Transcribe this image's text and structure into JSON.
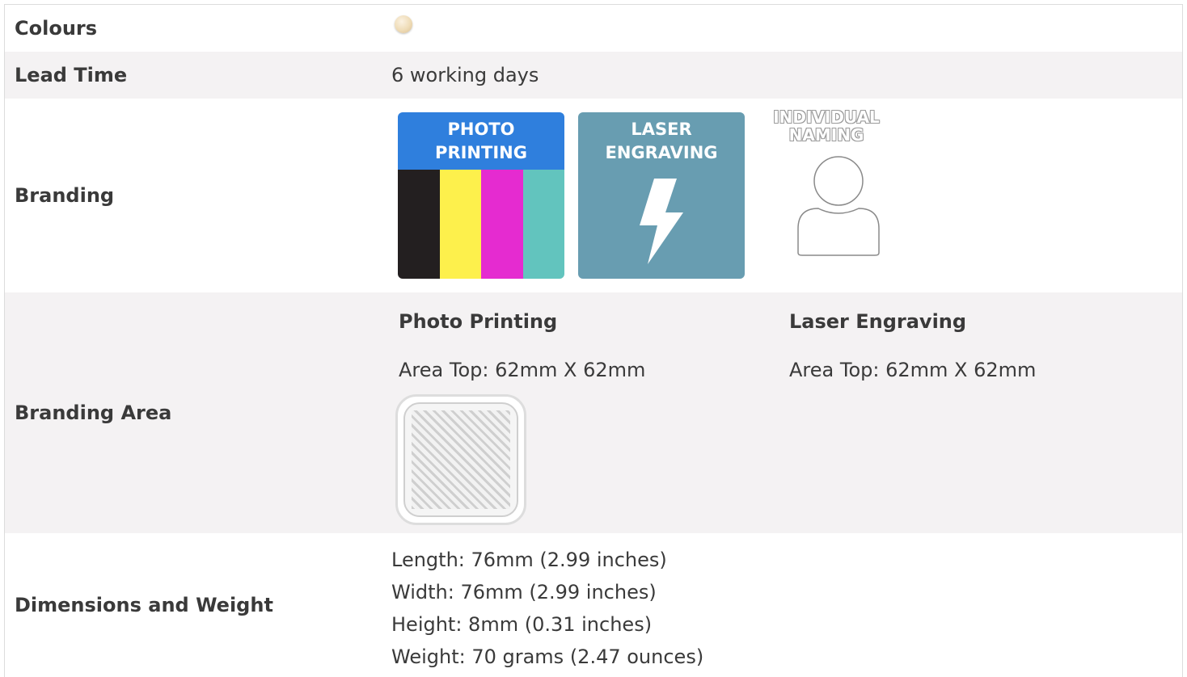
{
  "rows": {
    "colours": {
      "label": "Colours",
      "swatch_color": "#efdcb7"
    },
    "lead_time": {
      "label": "Lead Time",
      "value": "6 working days"
    },
    "branding": {
      "label": "Branding",
      "photo_printing": {
        "line1": "PHOTO",
        "line2": "PRINTING",
        "bar_colors": [
          "#231f20",
          "#fdf04c",
          "#e52bd0",
          "#62c4be"
        ],
        "header_color": "#2f7fdd"
      },
      "laser_engraving": {
        "line1": "LASER",
        "line2": "ENGRAVING",
        "icon": "lightning-bolt-icon",
        "bg_color": "#689db1"
      },
      "individual_naming": {
        "line1": "INDIVIDUAL",
        "line2": "NAMING",
        "icon": "person-icon"
      }
    },
    "branding_area": {
      "label": "Branding Area",
      "photo": {
        "title": "Photo Printing",
        "area": "Area Top: 62mm X 62mm"
      },
      "laser": {
        "title": "Laser Engraving",
        "area": "Area Top: 62mm X 62mm"
      }
    },
    "dimensions": {
      "label": "Dimensions and Weight",
      "lines": [
        "Length: 76mm (2.99 inches)",
        "Width: 76mm (2.99 inches)",
        "Height: 8mm (0.31 inches)",
        "Weight: 70 grams (2.47 ounces)"
      ]
    }
  }
}
